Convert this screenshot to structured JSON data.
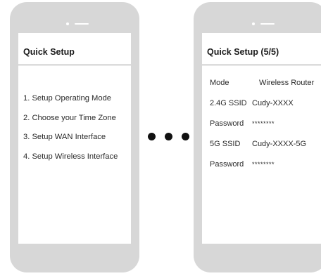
{
  "left_phone": {
    "title": "Quick Setup",
    "steps": [
      "1. Setup Operating Mode",
      "2. Choose your Time Zone",
      "3. Setup WAN Interface",
      "4. Setup Wireless Interface"
    ]
  },
  "separator": "ellipsis-dots",
  "right_phone": {
    "title": "Quick Setup (5/5)",
    "rows": [
      {
        "label": "Mode",
        "value": "Wireless Router"
      },
      {
        "label": "2.4G SSID",
        "value": "Cudy-XXXX"
      },
      {
        "label": "Password",
        "value": "********"
      },
      {
        "label": "5G SSID",
        "value": "Cudy-XXXX-5G"
      },
      {
        "label": "Password",
        "value": "********"
      }
    ]
  }
}
